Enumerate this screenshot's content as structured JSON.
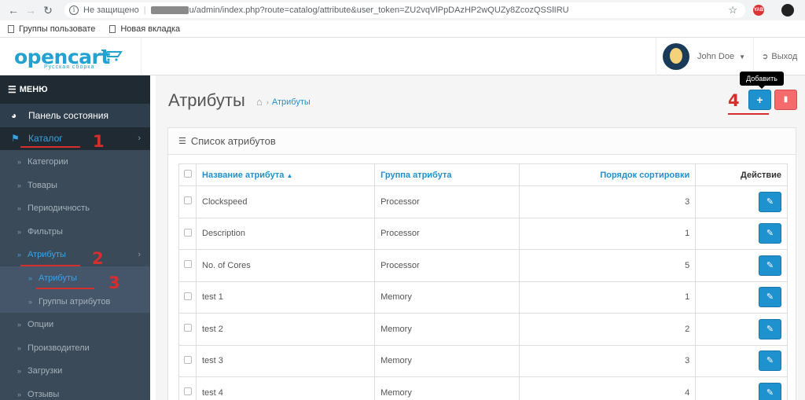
{
  "browser": {
    "address_security": "Не защищено",
    "address_url": "u/admin/index.php?route=catalog/attribute&user_token=ZU2vqVlPpDAzHP2wQUZy8ZcozQSSlIRU",
    "bookmarks": [
      "Группы пользовате",
      "Новая вкладка"
    ],
    "ext1_label": "YAB"
  },
  "header": {
    "logo_text": "opencart",
    "logo_sub": "Русская сборка",
    "user_name": "John Doe",
    "logout_label": "Выход"
  },
  "sidebar": {
    "menu_label": "МЕНЮ",
    "items": [
      {
        "label": "Панель состояния"
      },
      {
        "label": "Каталог"
      },
      {
        "label": "Категории"
      },
      {
        "label": "Товары"
      },
      {
        "label": "Периодичность"
      },
      {
        "label": "Фильтры"
      },
      {
        "label": "Атрибуты"
      },
      {
        "label": "Атрибуты"
      },
      {
        "label": "Группы атрибутов"
      },
      {
        "label": "Опции"
      },
      {
        "label": "Производители"
      },
      {
        "label": "Загрузки"
      },
      {
        "label": "Отзывы"
      }
    ]
  },
  "annotations": [
    "1",
    "2",
    "3",
    "4"
  ],
  "main": {
    "page_title": "Атрибуты",
    "breadcrumb": "Атрибуты",
    "add_tooltip": "Добавить",
    "panel_title": "Список атрибутов",
    "columns": {
      "name": "Название атрибута",
      "group": "Группа атрибута",
      "sort": "Порядок сортировки",
      "action": "Действие"
    },
    "rows": [
      {
        "name": "Clockspeed",
        "group": "Processor",
        "sort": "3"
      },
      {
        "name": "Description",
        "group": "Processor",
        "sort": "1"
      },
      {
        "name": "No. of Cores",
        "group": "Processor",
        "sort": "5"
      },
      {
        "name": "test 1",
        "group": "Memory",
        "sort": "1"
      },
      {
        "name": "test 2",
        "group": "Memory",
        "sort": "2"
      },
      {
        "name": "test 3",
        "group": "Memory",
        "sort": "3"
      },
      {
        "name": "test 4",
        "group": "Memory",
        "sort": "4"
      }
    ]
  }
}
